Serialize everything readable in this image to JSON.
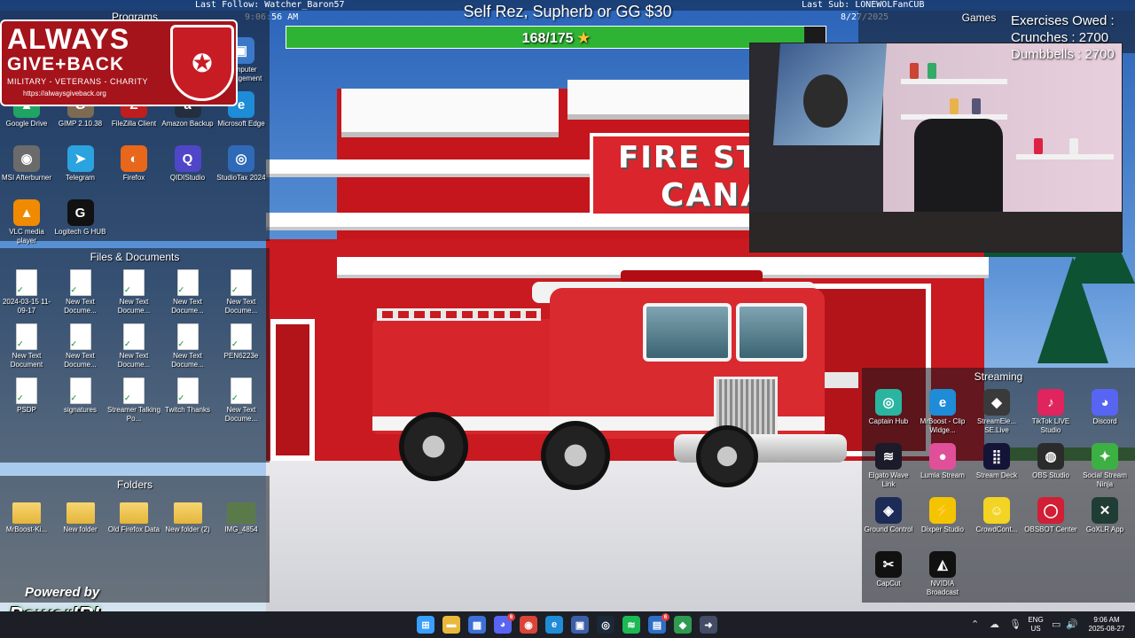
{
  "overlay": {
    "last_follow": "Last Follow: Watcher_Baron57",
    "last_sub": "Last Sub: LONEWOLFanCUB",
    "clock": "9:06:56 AM",
    "date": "8/27/2025",
    "goal_title": "Self Rez, Supherb or GG $30",
    "goal_text": "168/175",
    "goal_current": 168,
    "goal_target": 175,
    "goal_color": "#2fb334"
  },
  "exercises": {
    "title": "Exercises Owed :",
    "crunches": "Crunches : 2700",
    "dumbbells": "Dumbbells : 2700"
  },
  "logo": {
    "always": "ALWAYS",
    "give_back": "GIVE+BACK",
    "tagline": "MILITARY - VETERANS - CHARITY",
    "url": "https://alwaysgiveback.org",
    "brand_color": "#a5131b"
  },
  "powered": {
    "by": "Powered by",
    "name": "PowerIRL"
  },
  "wallpaper": {
    "sign_line1": "FIRE STA",
    "sign_line2": "CANA"
  },
  "fences": {
    "programs": {
      "title": "Programs",
      "items": [
        {
          "label": "Computer\nManagement",
          "icon": "computer-management-icon",
          "glyph": "▣",
          "color": "#3a79c9"
        },
        {
          "label": "Google Drive",
          "icon": "google-drive-icon",
          "glyph": "▲",
          "color": "#1fa463"
        },
        {
          "label": "GIMP 2.10.38",
          "icon": "gimp-icon",
          "glyph": "G",
          "color": "#7d6a52"
        },
        {
          "label": "FileZilla Client",
          "icon": "filezilla-icon",
          "glyph": "Z",
          "color": "#bf1e1e"
        },
        {
          "label": "Amazon Backup",
          "icon": "amazon-backup-icon",
          "glyph": "a",
          "color": "#232f3e"
        },
        {
          "label": "Microsoft Edge",
          "icon": "edge-icon",
          "glyph": "e",
          "color": "#1e8cd6"
        },
        {
          "label": "MSI Afterburner",
          "icon": "msi-afterburner-icon",
          "glyph": "◉",
          "color": "#6b6b6b"
        },
        {
          "label": "Telegram",
          "icon": "telegram-icon",
          "glyph": "➤",
          "color": "#2aa3df"
        },
        {
          "label": "Firefox",
          "icon": "firefox-icon",
          "glyph": "◐",
          "color": "#e8671b"
        },
        {
          "label": "QIDIStudio",
          "icon": "qidistudio-icon",
          "glyph": "Q",
          "color": "#4f46c8"
        },
        {
          "label": "StudioTax 2024",
          "icon": "studiotax-icon",
          "glyph": "◎",
          "color": "#2f6ab8"
        },
        {
          "label": "VLC media player",
          "icon": "vlc-icon",
          "glyph": "▲",
          "color": "#f08a00"
        },
        {
          "label": "Logitech G HUB",
          "icon": "logitech-ghub-icon",
          "glyph": "G",
          "color": "#111111"
        }
      ]
    },
    "files": {
      "title": "Files & Documents",
      "items": [
        {
          "label": "2024-03-15 11-09-17",
          "icon": "document-icon"
        },
        {
          "label": "New Text Docume...",
          "icon": "text-document-icon"
        },
        {
          "label": "New Text Docume...",
          "icon": "text-document-icon"
        },
        {
          "label": "New Text Docume...",
          "icon": "text-document-icon"
        },
        {
          "label": "New Text Docume...",
          "icon": "text-document-icon"
        },
        {
          "label": "New Text Document",
          "icon": "text-document-icon"
        },
        {
          "label": "New Text Docume...",
          "icon": "text-document-icon"
        },
        {
          "label": "New Text Docume...",
          "icon": "text-document-icon"
        },
        {
          "label": "New Text Docume...",
          "icon": "text-document-icon"
        },
        {
          "label": "PEN6223e",
          "icon": "chrome-document-icon"
        },
        {
          "label": "PSDP",
          "icon": "document-icon"
        },
        {
          "label": "signatures",
          "icon": "edge-document-icon"
        },
        {
          "label": "Streamer Talking Po...",
          "icon": "text-document-icon"
        },
        {
          "label": "Twitch Thanks",
          "icon": "text-document-icon"
        },
        {
          "label": "New Text Docume...",
          "icon": "text-document-icon"
        }
      ]
    },
    "folders": {
      "title": "Folders",
      "items": [
        {
          "label": "MrBoost-Ki...",
          "icon": "folder-icon"
        },
        {
          "label": "New folder",
          "icon": "folder-icon"
        },
        {
          "label": "Old Firefox Data",
          "icon": "folder-icon"
        },
        {
          "label": "New folder (2)",
          "icon": "folder-icon"
        },
        {
          "label": "IMG_4854",
          "icon": "image-icon"
        }
      ]
    },
    "games": {
      "title": "Games"
    },
    "streaming": {
      "title": "Streaming",
      "items": [
        {
          "label": "Captain Hub",
          "icon": "captain-hub-icon",
          "glyph": "◎",
          "color": "#2ab5a0"
        },
        {
          "label": "MrBoost - Clip Widge...",
          "icon": "edge-icon",
          "glyph": "e",
          "color": "#1e8cd6"
        },
        {
          "label": "StreamEle... SE.Live",
          "icon": "streamelements-icon",
          "glyph": "◆",
          "color": "#3a3a3a"
        },
        {
          "label": "TikTok LIVE Studio",
          "icon": "tiktok-icon",
          "glyph": "♪",
          "color": "#e0245e"
        },
        {
          "label": "Discord",
          "icon": "discord-icon",
          "glyph": "◕",
          "color": "#5865f2"
        },
        {
          "label": "Elgato Wave Link",
          "icon": "elgato-wave-icon",
          "glyph": "≋",
          "color": "#1b1b2a"
        },
        {
          "label": "Lumia Stream",
          "icon": "lumia-stream-icon",
          "glyph": "●",
          "color": "#e0509a"
        },
        {
          "label": "Stream Deck",
          "icon": "stream-deck-icon",
          "glyph": "⣿",
          "color": "#141438"
        },
        {
          "label": "OBS Studio",
          "icon": "obs-studio-icon",
          "glyph": "◍",
          "color": "#2b2b2b"
        },
        {
          "label": "Social Stream Ninja",
          "icon": "social-stream-ninja-icon",
          "glyph": "✦",
          "color": "#3cb043"
        },
        {
          "label": "Ground Control",
          "icon": "ground-control-icon",
          "glyph": "◈",
          "color": "#1d2b57"
        },
        {
          "label": "Dixper Studio",
          "icon": "dixper-icon",
          "glyph": "⚡",
          "color": "#f5c400"
        },
        {
          "label": "CrowdCont...",
          "icon": "crowdcontrol-icon",
          "glyph": "☺",
          "color": "#f3d324"
        },
        {
          "label": "OBSBOT Center",
          "icon": "obsbot-icon",
          "glyph": "◯",
          "color": "#d11f35"
        },
        {
          "label": "GoXLR App",
          "icon": "goxlr-icon",
          "glyph": "✕",
          "color": "#1f3d34"
        },
        {
          "label": "CapCut",
          "icon": "capcut-icon",
          "glyph": "✂",
          "color": "#111111"
        },
        {
          "label": "NVIDIA Broadcast",
          "icon": "nvidia-broadcast-icon",
          "glyph": "◭",
          "color": "#111111"
        }
      ]
    }
  },
  "taskbar": {
    "items": [
      {
        "name": "start-icon",
        "glyph": "⊞",
        "color": "#3aa0ff"
      },
      {
        "name": "file-explorer-icon",
        "glyph": "▬",
        "color": "#e9b93b"
      },
      {
        "name": "microsoft-store-icon",
        "glyph": "▦",
        "color": "#3d6fd8"
      },
      {
        "name": "discord-taskbar-icon",
        "glyph": "◕",
        "color": "#5865f2",
        "badge": "6"
      },
      {
        "name": "chrome-icon",
        "glyph": "◉",
        "color": "#db4437"
      },
      {
        "name": "edge-taskbar-icon",
        "glyph": "e",
        "color": "#1e8cd6"
      },
      {
        "name": "media-app-icon",
        "glyph": "▣",
        "color": "#3c5fa8"
      },
      {
        "name": "steam-icon",
        "glyph": "◎",
        "color": "#1b2838"
      },
      {
        "name": "spotify-icon",
        "glyph": "≋",
        "color": "#1db954"
      },
      {
        "name": "app-icon-blue",
        "glyph": "▤",
        "color": "#2f6ec7",
        "badge": "6"
      },
      {
        "name": "app-icon-green",
        "glyph": "◆",
        "color": "#2e9b50"
      },
      {
        "name": "app-icon-arrow",
        "glyph": "➜",
        "color": "#444c66"
      }
    ],
    "tray": {
      "lang_top": "ENG",
      "lang_bottom": "US",
      "time": "9:06 AM",
      "date": "2025-08-27"
    }
  }
}
